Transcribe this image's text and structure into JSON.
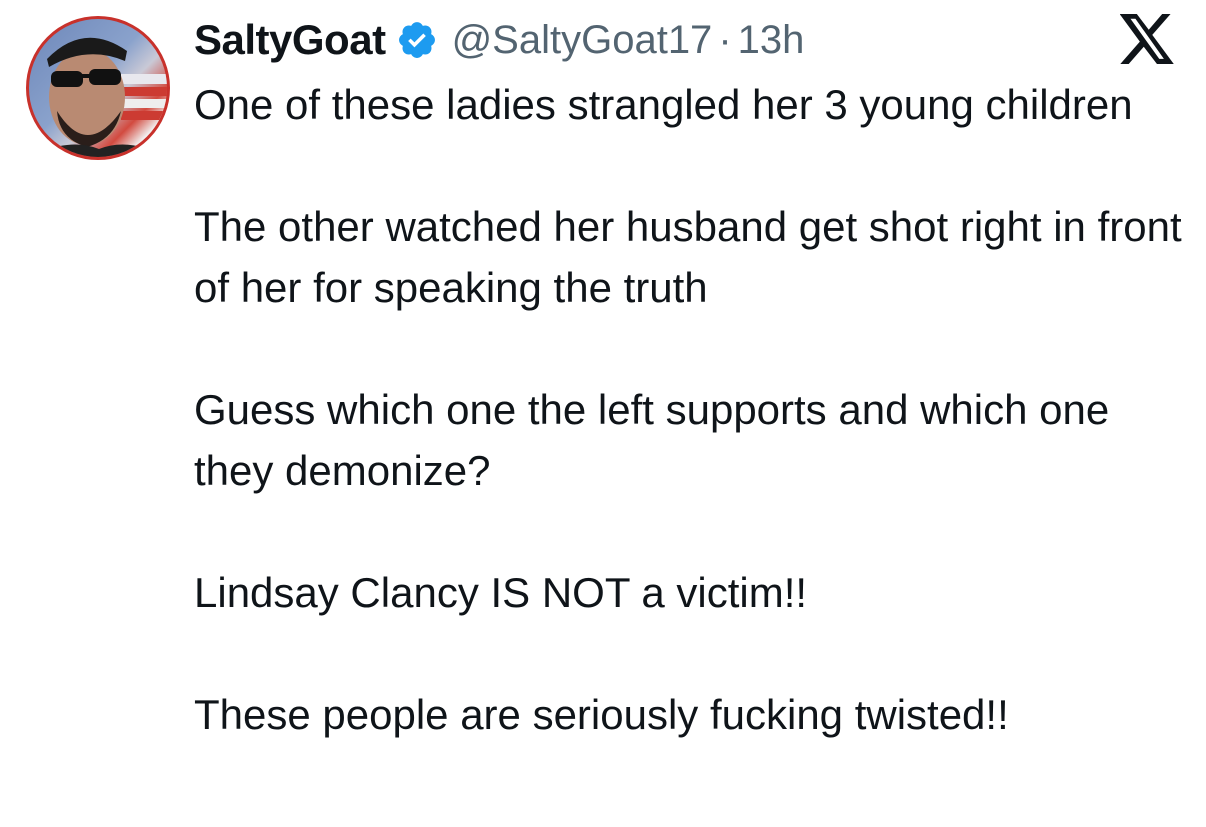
{
  "author": {
    "display_name": "SaltyGoat",
    "handle": "@SaltyGoat17",
    "separator": "·",
    "timestamp": "13h",
    "verified": true,
    "verified_color": "#1d9bf0"
  },
  "platform": {
    "logo_icon": "x-logo-icon"
  },
  "tweet": {
    "paragraphs": [
      "One of these ladies strangled her 3 young children",
      "The other watched her husband get shot right in front of her for speaking the truth",
      "Guess which one the left supports and which one they demonize?",
      "Lindsay Clancy IS NOT a victim!!",
      "These people are seriously fucking twisted!!"
    ]
  }
}
